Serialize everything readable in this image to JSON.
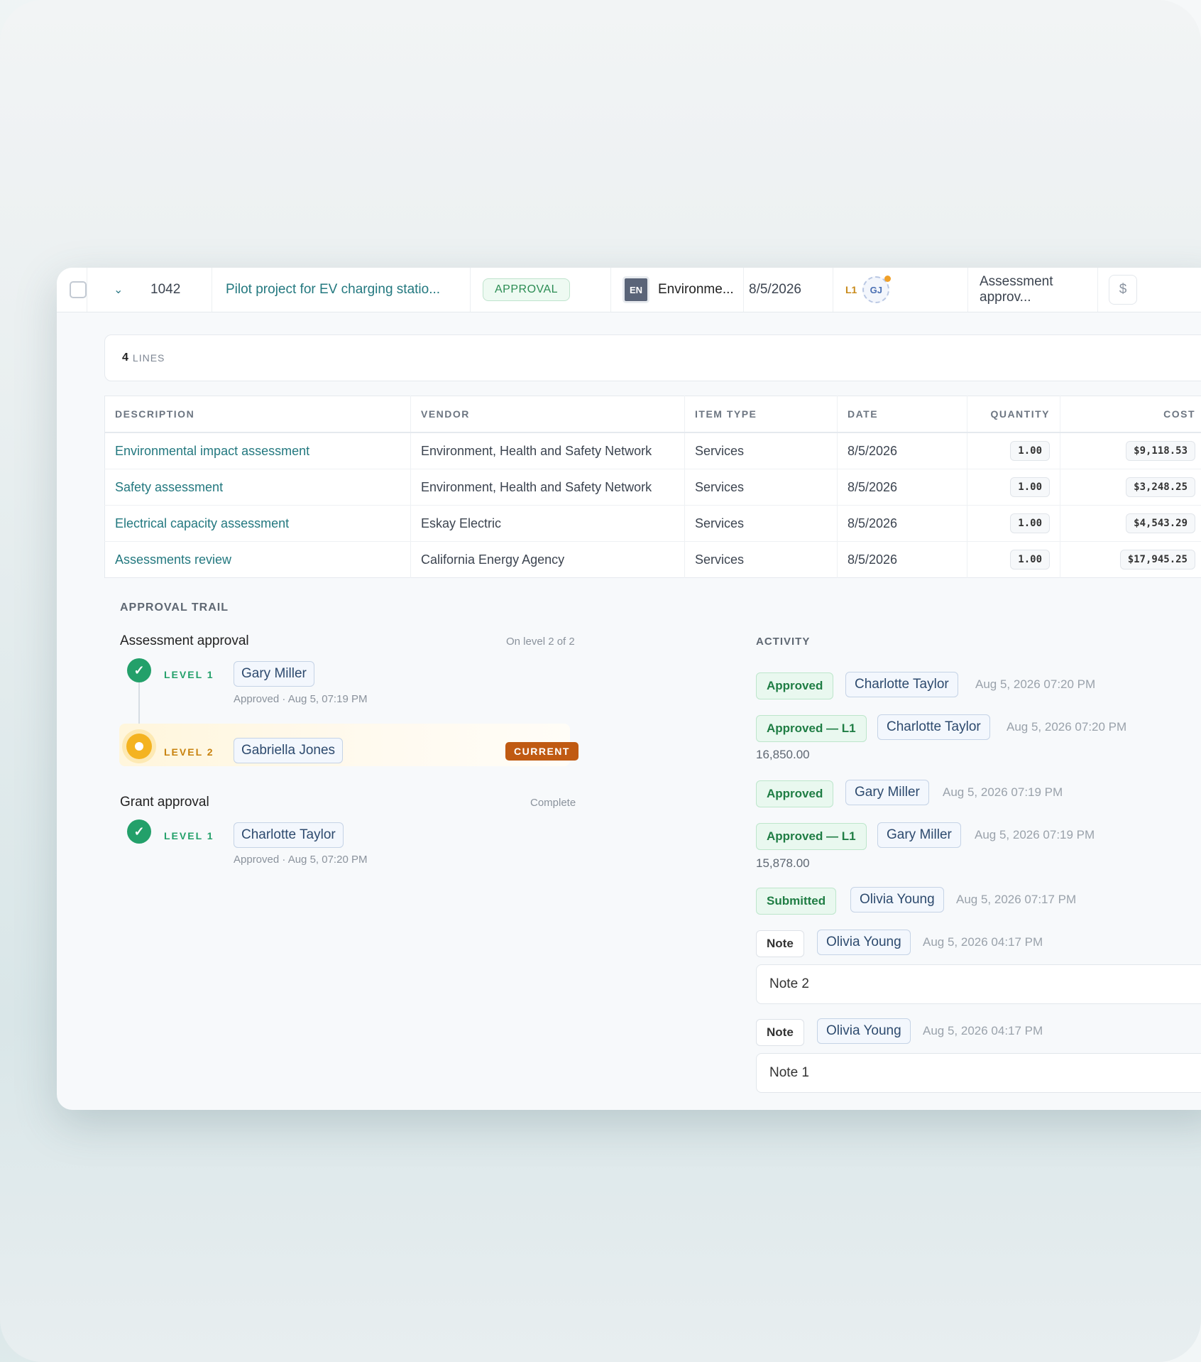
{
  "header_row": {
    "id": "1042",
    "title": "Pilot project for EV charging statio...",
    "status": "APPROVAL",
    "vendor_abbr": "EN",
    "vendor": "Environme...",
    "date": "8/5/2026",
    "level": "L1",
    "approver_initials": "GJ",
    "workflow": "Assessment approv...",
    "currency_icon": "$"
  },
  "lines": {
    "count": "4",
    "label": "LINES",
    "headers": [
      "DESCRIPTION",
      "VENDOR",
      "ITEM TYPE",
      "DATE",
      "QUANTITY",
      "COST"
    ],
    "rows": [
      {
        "description": "Environmental impact assessment",
        "vendor": "Environment, Health and Safety Network",
        "item_type": "Services",
        "date": "8/5/2026",
        "quantity": "1.00",
        "cost": "$9,118.53"
      },
      {
        "description": "Safety assessment",
        "vendor": "Environment, Health and Safety Network",
        "item_type": "Services",
        "date": "8/5/2026",
        "quantity": "1.00",
        "cost": "$3,248.25"
      },
      {
        "description": "Electrical capacity assessment",
        "vendor": "Eskay Electric",
        "item_type": "Services",
        "date": "8/5/2026",
        "quantity": "1.00",
        "cost": "$4,543.29"
      },
      {
        "description": "Assessments review",
        "vendor": "California Energy Agency",
        "item_type": "Services",
        "date": "8/5/2026",
        "quantity": "1.00",
        "cost": "$17,945.25"
      }
    ]
  },
  "approval_trail": {
    "title": "APPROVAL TRAIL",
    "groups": [
      {
        "name": "Assessment approval",
        "meta": "On level 2 of 2",
        "steps": [
          {
            "level": "LEVEL 1",
            "person": "Gary Miller",
            "sub": "Approved · Aug 5, 07:19 PM"
          },
          {
            "level": "LEVEL 2",
            "person": "Gabriella Jones",
            "badge": "CURRENT"
          }
        ]
      },
      {
        "name": "Grant approval",
        "meta": "Complete",
        "steps": [
          {
            "level": "LEVEL 1",
            "person": "Charlotte Taylor",
            "sub": "Approved · Aug 5, 07:20 PM"
          }
        ]
      }
    ]
  },
  "activity": {
    "title": "ACTIVITY",
    "items": [
      {
        "action": "Approved",
        "person": "Charlotte Taylor",
        "time": "Aug 5, 2026 07:20 PM"
      },
      {
        "action": "Approved — L1",
        "person": "Charlotte Taylor",
        "time": "Aug 5, 2026 07:20 PM",
        "amount": "16,850.00"
      },
      {
        "action": "Approved",
        "person": "Gary Miller",
        "time": "Aug 5, 2026 07:19 PM"
      },
      {
        "action": "Approved — L1",
        "person": "Gary Miller",
        "time": "Aug 5, 2026 07:19 PM",
        "amount": "15,878.00"
      },
      {
        "action": "Submitted",
        "person": "Olivia Young",
        "time": "Aug 5, 2026 07:17 PM"
      },
      {
        "action": "Note",
        "person": "Olivia Young",
        "time": "Aug 5, 2026 04:17 PM",
        "note": "Note 2"
      },
      {
        "action": "Note",
        "person": "Olivia Young",
        "time": "Aug 5, 2026 04:17 PM",
        "note": "Note 1"
      }
    ]
  },
  "colors": {
    "accent_link": "#23787f",
    "approved_green": "#23a06a",
    "current_orange": "#c05a12"
  }
}
